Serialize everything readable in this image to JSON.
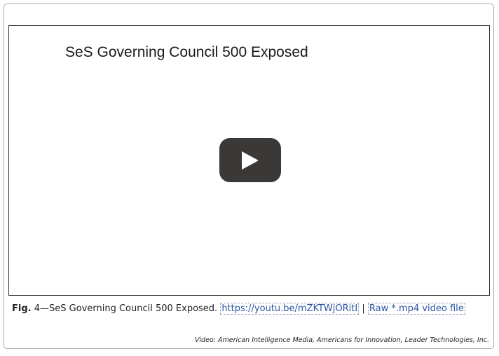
{
  "video": {
    "title": "SeS Governing Council 500 Exposed",
    "play_icon": "play-icon"
  },
  "caption": {
    "label": "Fig.",
    "number": "4",
    "dash": "—",
    "text": "SeS Governing Council 500 Exposed.",
    "link_youtube": "https://youtu.be/mZKTWjORitI",
    "separator": "|",
    "link_raw": "Raw *.mp4 video file"
  },
  "credit": "Video: American Intelligence Media, Americans for Innovation, Leader Technologies, Inc.",
  "colors": {
    "link": "#2a55a3",
    "play_button_bg": "#3b3838",
    "frame_border": "#a9a9a9"
  }
}
